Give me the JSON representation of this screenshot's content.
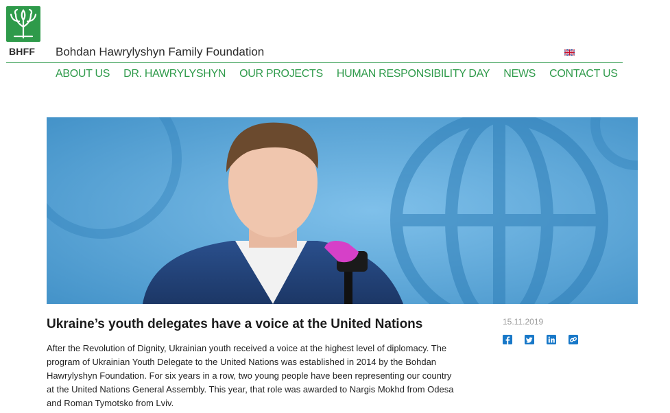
{
  "brand": {
    "abbr": "BHFF",
    "title": "Bohdan Hawrylyshyn Family Foundation",
    "color": "#2e9a4a"
  },
  "lang": {
    "icon": "uk-flag-icon"
  },
  "nav": {
    "items": [
      {
        "label": "ABOUT US"
      },
      {
        "label": "DR. HAWRYLYSHYN"
      },
      {
        "label": "OUR PROJECTS"
      },
      {
        "label": "HUMAN RESPONSIBILITY DAY"
      },
      {
        "label": "NEWS"
      },
      {
        "label": "CONTACT US"
      }
    ]
  },
  "article": {
    "title": "Ukraine’s youth delegates have a voice at the United Nations",
    "date": "15.11.2019",
    "body": "After the Revolution of Dignity, Ukrainian youth received a voice at the highest level of diplomacy. The program of Ukrainian Youth Delegate to the United Nations was established in 2014 by the Bohdan Hawrylyshyn Foundation. For six years in a row, two young people have been representing our country at the United Nations General Assembly. This year, that role was awarded to Nargis Mokhd from Odesa and Roman Tymotsko from Lviv.",
    "share": {
      "facebook": "facebook-icon",
      "twitter": "twitter-icon",
      "linkedin": "linkedin-icon",
      "link": "link-icon",
      "color": "#1878c8"
    }
  }
}
